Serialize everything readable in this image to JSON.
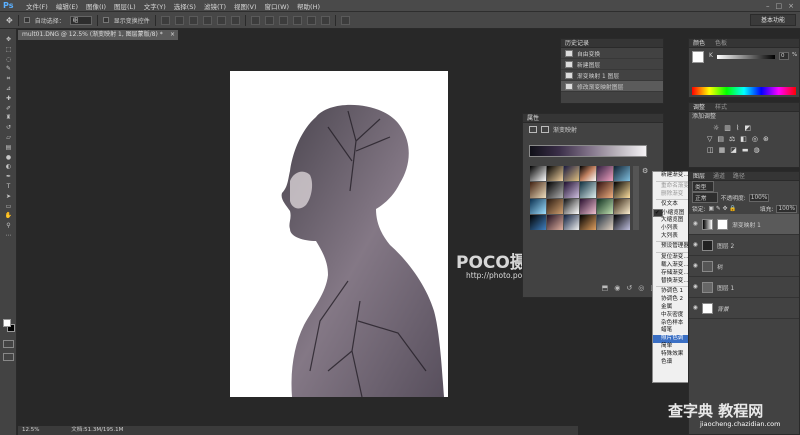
{
  "menubar": {
    "app_icon": "Ps",
    "items": [
      "文件(F)",
      "编辑(E)",
      "图像(I)",
      "图层(L)",
      "文字(Y)",
      "选择(S)",
      "滤镜(T)",
      "视图(V)",
      "窗口(W)",
      "帮助(H)"
    ]
  },
  "options": {
    "auto_select": "自动选择：",
    "auto_select_value": "组",
    "show_transform": "显示变换控件",
    "workspace": "基本功能"
  },
  "document": {
    "tab_title": "mult01.DNG @ 12.5% (渐变映射 1, 图层蒙版/8) *",
    "tab_close": "×"
  },
  "status": {
    "zoom": "12.5%",
    "doc_size": "文档:51.3M/195.1M"
  },
  "watermark": {
    "brand": "POCO摄影专题",
    "url": "http://photo.poco.cn/"
  },
  "history": {
    "title": "历史记录",
    "rows": [
      "自由变换",
      "新建图层",
      "渐变映射 1 图层",
      "修改渐变映射图层"
    ]
  },
  "properties": {
    "title": "属性",
    "adjustment_name": "渐变映射"
  },
  "menu": {
    "items": [
      {
        "label": "新建渐变...",
        "state": "normal"
      },
      {
        "sep": true
      },
      {
        "label": "重命名渐变...",
        "state": "disabled"
      },
      {
        "label": "删除渐变",
        "state": "disabled"
      },
      {
        "sep": true
      },
      {
        "label": "仅文本",
        "state": "normal"
      },
      {
        "label": "小缩览图",
        "state": "checked"
      },
      {
        "label": "大缩览图",
        "state": "normal"
      },
      {
        "label": "小列表",
        "state": "normal"
      },
      {
        "label": "大列表",
        "state": "normal"
      },
      {
        "sep": true
      },
      {
        "label": "预设管理器...",
        "state": "normal"
      },
      {
        "sep": true
      },
      {
        "label": "复位渐变...",
        "state": "normal"
      },
      {
        "label": "载入渐变...",
        "state": "normal"
      },
      {
        "label": "存储渐变...",
        "state": "normal"
      },
      {
        "label": "替换渐变...",
        "state": "normal"
      },
      {
        "sep": true
      },
      {
        "label": "协调色 1",
        "state": "normal"
      },
      {
        "label": "协调色 2",
        "state": "normal"
      },
      {
        "label": "金属",
        "state": "normal"
      },
      {
        "label": "中灰密度",
        "state": "normal"
      },
      {
        "label": "杂色样本",
        "state": "normal"
      },
      {
        "label": "蜡笔",
        "state": "normal"
      },
      {
        "label": "照片色调",
        "state": "highlighted"
      },
      {
        "label": "简单",
        "state": "normal"
      },
      {
        "label": "特殊效果",
        "state": "normal"
      },
      {
        "label": "色谱",
        "state": "normal"
      }
    ]
  },
  "color_panel": {
    "tabs": [
      "颜色",
      "色板"
    ],
    "channel": "K",
    "value": "0",
    "unit": "%"
  },
  "adjustments": {
    "tabs": [
      "调整",
      "样式"
    ],
    "label": "添加调整"
  },
  "layers": {
    "tabs": [
      "图层",
      "通道",
      "路径"
    ],
    "kind": "类型",
    "blend": "正常",
    "opacity_label": "不透明度:",
    "opacity": "100%",
    "lock_label": "锁定:",
    "fill_label": "填充:",
    "fill": "100%",
    "rows": [
      "渐变映射 1",
      "图层 2",
      "树",
      "图层 1",
      "背景"
    ]
  },
  "footer_watermark": {
    "brand": "查字典 教程网",
    "url": "jiaocheng.chazidian.com"
  },
  "colors": {
    "accent": "#3a6fc4",
    "ps_blue": "#5ab0ff",
    "canvas": "#ffffff",
    "workspace_bg": "#282828"
  }
}
